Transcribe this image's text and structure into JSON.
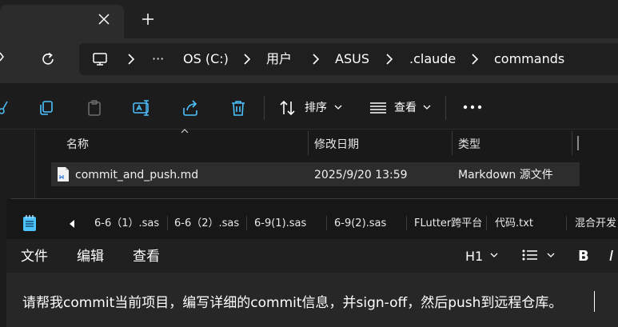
{
  "explorer": {
    "breadcrumbs": [
      "OS (C:)",
      "用户",
      "ASUS",
      ".claude",
      "commands"
    ],
    "overflow_label": "···",
    "commands": {
      "sort_label": "排序",
      "view_label": "查看",
      "more_label": "···"
    },
    "columns": [
      "名称",
      "修改日期",
      "类型"
    ],
    "files": [
      {
        "name": "commit_and_push.md",
        "modified": "2025/9/20 13:59",
        "type": "Markdown 源文件"
      }
    ]
  },
  "notepad": {
    "tabs": [
      "6-6（1）.sas",
      "6-6（2）.sas",
      "6-9(1).sas",
      "6-9(2).sas",
      "FLutter跨平台",
      "代码.txt",
      "混合开发"
    ],
    "menu": [
      "文件",
      "编辑",
      "查看"
    ],
    "heading_level": "H1",
    "bold_label": "B",
    "italic_label": "I",
    "content": "请帮我commit当前项目，编写详细的commit信息，并sign-off，然后push到远程仓库。"
  },
  "colors": {
    "accent": "#4cc2ff",
    "window_bg": "#202020",
    "selection": "#2d2d2d"
  }
}
